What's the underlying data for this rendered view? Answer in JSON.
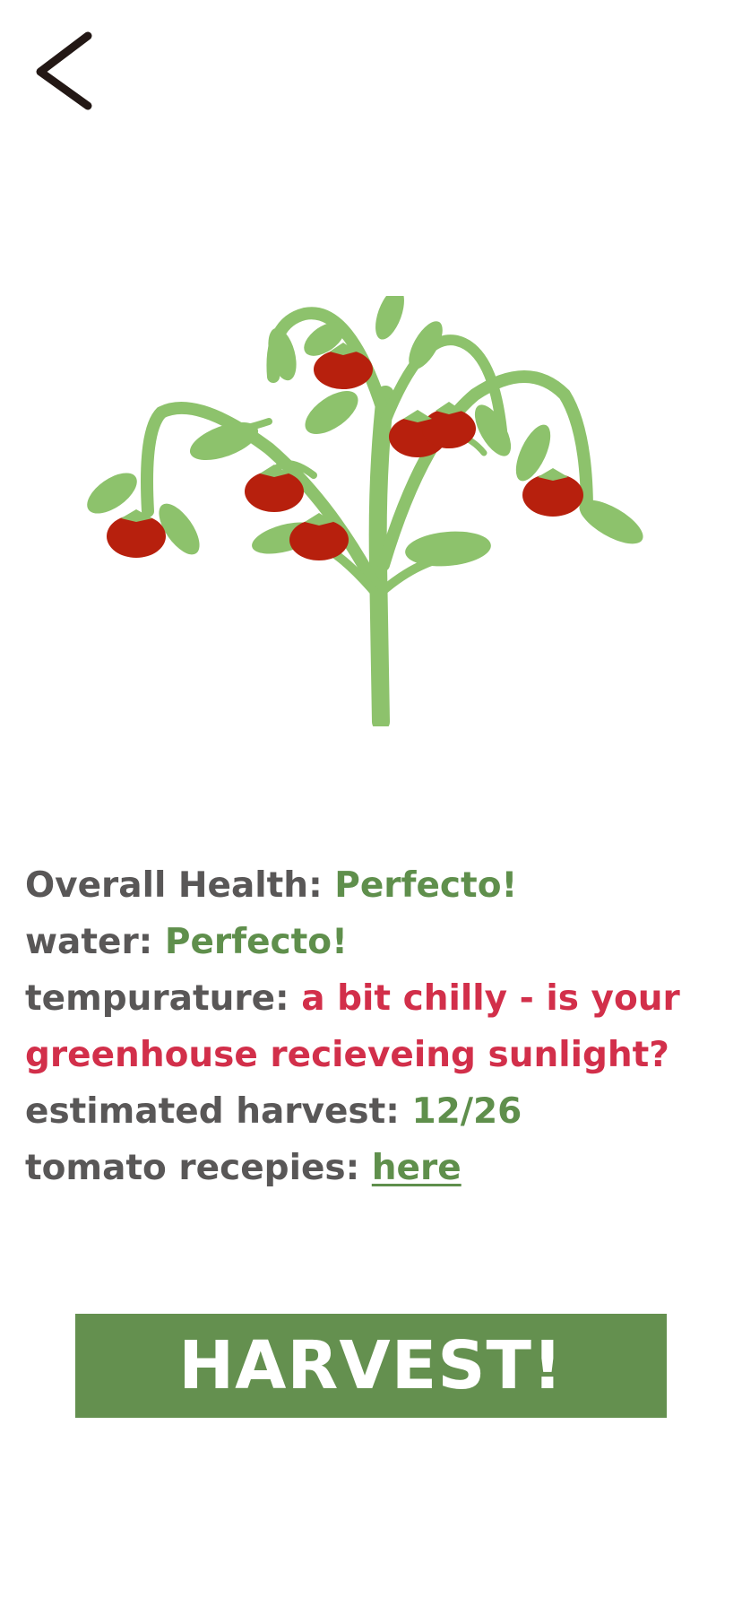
{
  "nav": {
    "back_icon": "chevron-left-icon"
  },
  "plant": {
    "illustration": "tomato-plant",
    "stem_color": "#8dc26c",
    "tomato_color": "#b7200d"
  },
  "stats": {
    "overall_health": {
      "label": "Overall Health:",
      "value": "Perfecto!"
    },
    "water": {
      "label": "water:",
      "value": "Perfecto!"
    },
    "temperature": {
      "label": "tempurature:",
      "value_line1": "a bit chilly - is your",
      "value_line2": "greenhouse recieveing sunlight?"
    },
    "estimated_harvest": {
      "label": "estimated harvest:",
      "value": "12/26"
    },
    "recipes": {
      "label": "tomato recepies:",
      "link_text": "here"
    }
  },
  "actions": {
    "harvest_label": "HARVEST!"
  },
  "colors": {
    "label": "#595757",
    "good": "#5f8f4c",
    "warning": "#d22f4a",
    "button_bg": "#64904f",
    "button_text": "#ffffff"
  }
}
